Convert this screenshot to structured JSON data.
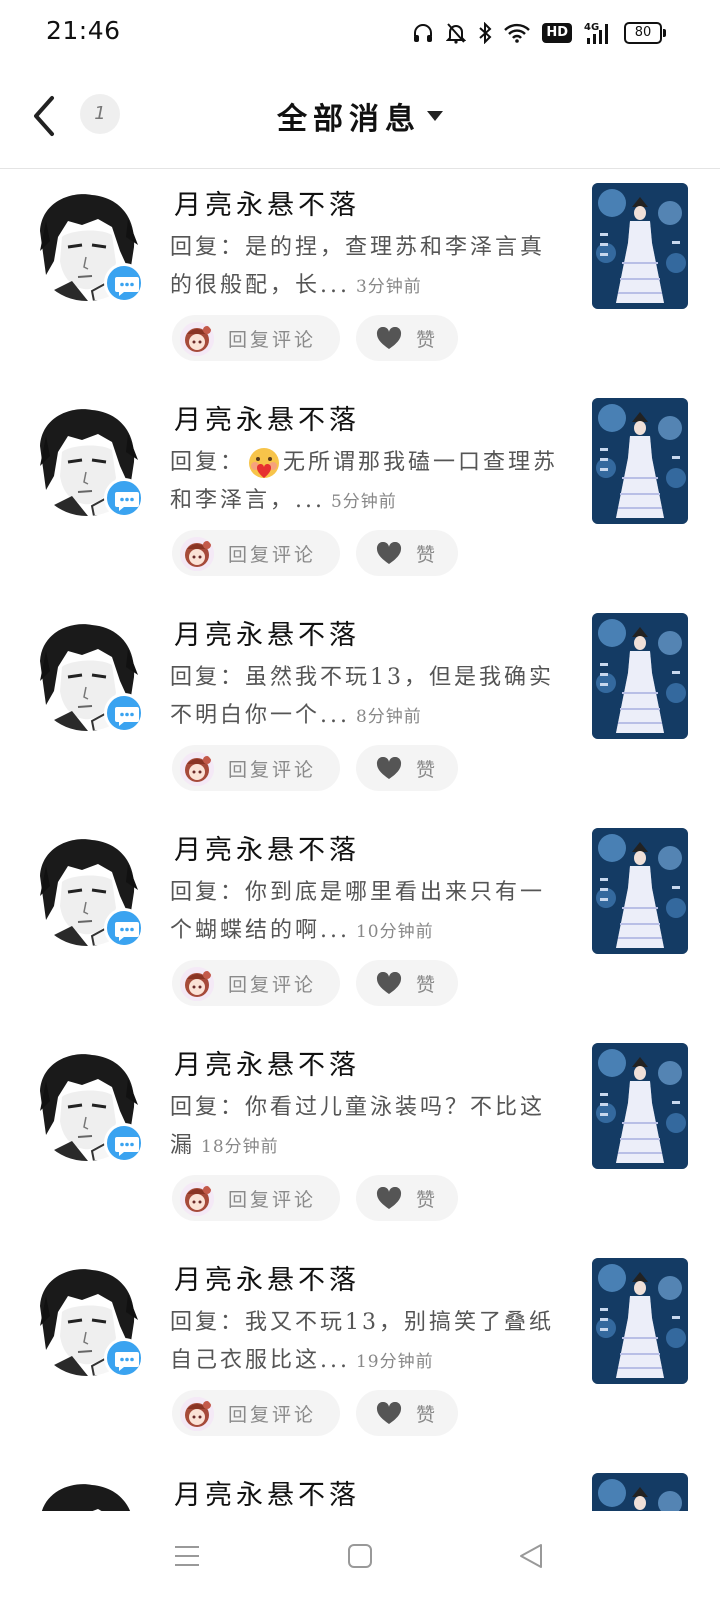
{
  "status_bar": {
    "time": "21:46",
    "network": "4G",
    "hd": "HD",
    "battery": "80",
    "icons": [
      "headphones-icon",
      "bell-off-icon",
      "bluetooth-icon",
      "wifi-icon",
      "hd-icon",
      "signal-icon",
      "battery-icon"
    ]
  },
  "header": {
    "title": "全部消息",
    "count": "1",
    "back_icon": "chevron-left-icon",
    "dropdown_icon": "caret-down-icon"
  },
  "actions": {
    "reply_label": "回复评论",
    "like_label": "赞"
  },
  "messages": [
    {
      "username": "月亮永悬不落",
      "reply": "回复：是的捏，查理苏和李泽言真的很般配，长...",
      "time": "3分钟前"
    },
    {
      "username": "月亮永悬不落",
      "reply_prefix": "回复：",
      "reply": "无所谓那我磕一口查理苏和李泽言，...",
      "time": "5分钟前"
    },
    {
      "username": "月亮永悬不落",
      "reply": "回复：虽然我不玩13，但是我确实不明白你一个...",
      "time": "8分钟前"
    },
    {
      "username": "月亮永悬不落",
      "reply": "回复：你到底是哪里看出来只有一个蝴蝶结的啊...",
      "time": "10分钟前"
    },
    {
      "username": "月亮永悬不落",
      "reply": "回复：你看过儿童泳装吗？不比这漏",
      "time": "18分钟前"
    },
    {
      "username": "月亮永悬不落",
      "reply": "回复：我又不玩13，别搞笑了叠纸自己衣服比这...",
      "time": "19分钟前"
    },
    {
      "username": "月亮永悬不落",
      "reply": "",
      "time": ""
    }
  ],
  "nav": {
    "icons": [
      "menu-icon",
      "home-square-icon",
      "back-triangle-icon"
    ]
  }
}
